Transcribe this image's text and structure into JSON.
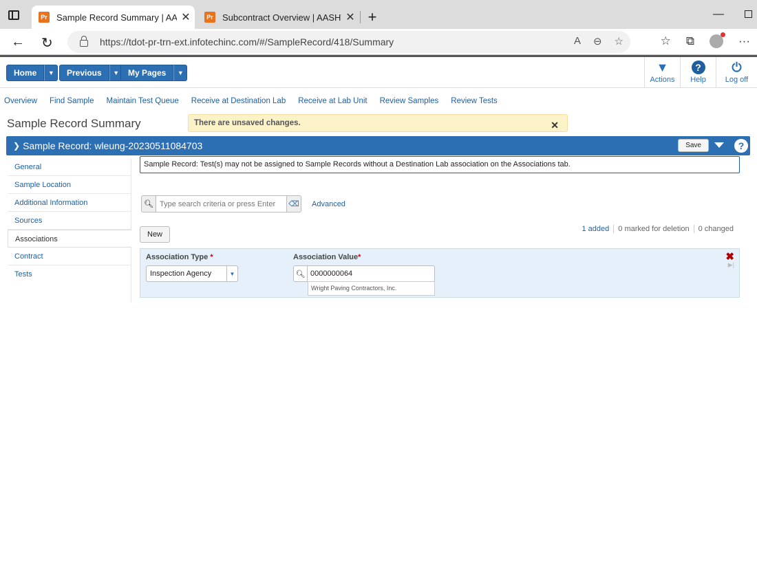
{
  "browser": {
    "tabs": [
      {
        "favicon": "Pr",
        "title": "Sample Record Summary | AASHTOWare",
        "active": true
      },
      {
        "favicon": "Pr",
        "title": "Subcontract Overview | AASHTOWare",
        "active": false
      }
    ],
    "url": "https://tdot-pr-trn-ext.infotechinc.com/#/SampleRecord/418/Summary"
  },
  "header": {
    "buttons": [
      {
        "label": "Home"
      },
      {
        "label": "Previous"
      },
      {
        "label": "My Pages"
      }
    ],
    "right": [
      {
        "icon": "chevron-down-icon",
        "label": "Actions"
      },
      {
        "icon": "help-icon",
        "label": "Help"
      },
      {
        "icon": "power-icon",
        "label": "Log off"
      }
    ]
  },
  "nav": {
    "links": [
      "Overview",
      "Find Sample",
      "Maintain Test Queue",
      "Receive at Destination Lab",
      "Receive at Lab Unit",
      "Review Samples",
      "Review Tests"
    ]
  },
  "page": {
    "title": "Sample Record Summary",
    "unsaved_message": "There are unsaved changes.",
    "record_title": "Sample Record: wleung-20230511084703",
    "save_label": "Save"
  },
  "sidebar": {
    "items": [
      {
        "label": "General",
        "active": false
      },
      {
        "label": "Sample Location",
        "active": false
      },
      {
        "label": "Additional Information",
        "active": false
      },
      {
        "label": "Sources",
        "active": false
      },
      {
        "label": "Associations",
        "active": true
      },
      {
        "label": "Contract",
        "active": false
      },
      {
        "label": "Tests",
        "active": false
      }
    ]
  },
  "main": {
    "message": "Sample Record: Test(s) may not be assigned to Sample Records without a Destination Lab association on the Associations tab.",
    "search_placeholder": "Type search criteria or press Enter",
    "advanced_label": "Advanced",
    "new_label": "New",
    "counts": {
      "added": "1 added",
      "deleted": "0 marked for deletion",
      "changed": "0 changed"
    },
    "association": {
      "type_label": "Association Type",
      "type_value": "Inspection Agency",
      "value_label": "Association Value",
      "value": "0000000064",
      "value_description": "Wright Paving Contractors, Inc."
    }
  }
}
